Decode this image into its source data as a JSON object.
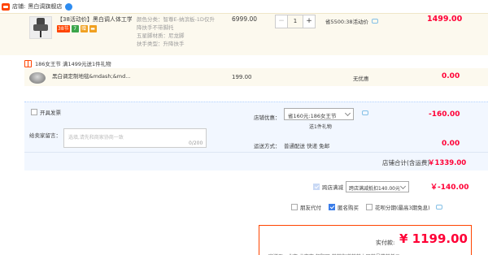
{
  "shop": {
    "label": "店铺:",
    "name": "黑白调旗舰店"
  },
  "item": {
    "title": "【38活动价】黑白调人体工学...",
    "badges": [
      {
        "text": "38节",
        "color": "#ff4400"
      },
      {
        "text": "7",
        "color": "#3ba64b"
      },
      {
        "text": "赠",
        "color": "#f0a020"
      },
      {
        "text": "▬",
        "color": "#f0a020"
      }
    ],
    "sku": [
      "颜色分类：智尊E-纳滨板-1D仅升",
      "降扶手不带脚托",
      "五星脚材质：尼龙脚",
      "扶手类型：升降扶手"
    ],
    "price": "6999.00",
    "quantity": "1",
    "qty_minus": "−",
    "qty_plus": "+",
    "promo": "省5500:38活动价",
    "total": "1499.00"
  },
  "gift": {
    "header": "186女王节   满1499元送1件礼物",
    "title": "黑白调定制地毯&mdash;&md...",
    "price": "199.00",
    "promo": "无优惠",
    "total": "0.00"
  },
  "options": {
    "invoice_label": "开具发票",
    "message_label": "给卖家留言：",
    "message_placeholder": "选填,请先和商家协商一致",
    "message_count": "0/200",
    "coupon_label": "店铺优惠：",
    "coupon_value": "省160元:186女王节",
    "coupon_gift": "送1件礼物",
    "coupon_total": "-160.00",
    "shipping_label": "运送方式：",
    "shipping_value": "普通配送 快递 免邮",
    "shipping_cost": "0.00",
    "shop_total_label": "店铺合计(含运费)",
    "shop_total_value": "￥1339.00"
  },
  "cross_store": {
    "label": "跨店满减",
    "select_value": "跨店满减抵扣140.00元",
    "value": "￥-140.00"
  },
  "payment_options": [
    {
      "label": "朋友代付",
      "checked": false
    },
    {
      "label": "匿名购买",
      "checked": true
    },
    {
      "label": "花呗分期(最高3期免息)",
      "checked": false
    }
  ],
  "pay": {
    "label": "实付款:",
    "amount": "¥ 1199.00",
    "cut_text": "寄送至：北京 北京市 朝阳区 某某街道某某小区某号楼某单元"
  },
  "colors": {
    "accent": "#ff0036",
    "panel": "#fcf9ee",
    "option_panel": "#f2f7ff",
    "brand": "#ff4400"
  },
  "icons": {
    "shop": "shop-icon",
    "wangwang": "wangwang-icon",
    "gift": "gift-icon",
    "chat": "chat-icon"
  }
}
